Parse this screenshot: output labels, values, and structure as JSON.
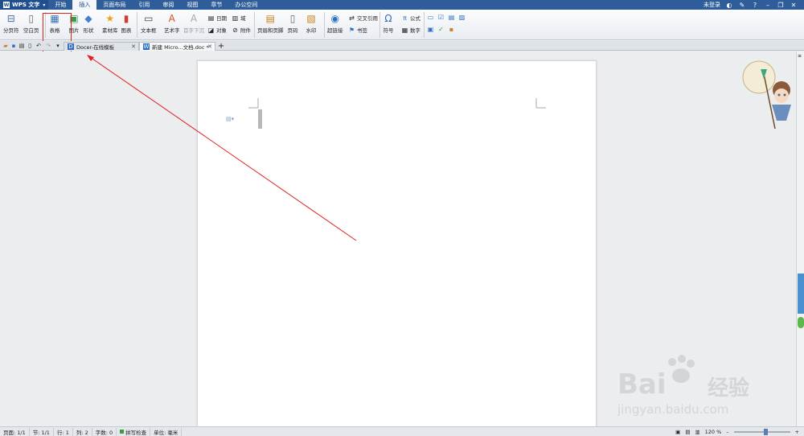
{
  "app": {
    "name": "WPS 文字",
    "login_status": "未登录"
  },
  "menu": {
    "tabs": [
      "开始",
      "插入",
      "页面布局",
      "引用",
      "审阅",
      "视图",
      "章节",
      "办公空间"
    ],
    "active_tab": "插入"
  },
  "ribbon": {
    "page_break": "分页符",
    "blank_page": "空白页",
    "table": "表格",
    "picture": "图片",
    "shape": "形状",
    "material": "素材库",
    "chart": "图表",
    "textbox": "文本框",
    "wordart": "艺术字",
    "drop_cap": "首字下沉",
    "date": "日期",
    "field": "域",
    "object": "对象",
    "attachment": "附件",
    "header_footer": "页眉和页脚",
    "page_number": "页码",
    "watermark": "水印",
    "hyperlink": "超链接",
    "cross_reference": "交叉引用",
    "bookmark": "书签",
    "symbol": "符号",
    "formula": "公式",
    "number": "数字"
  },
  "tabs": {
    "docer": "Docer-在线模板",
    "document": "新建 Micro...文档.doc *",
    "new_tab": "+"
  },
  "status": {
    "page": "页面: 1/1",
    "section": "节: 1/1",
    "row": "行: 1",
    "column": "列: 2",
    "word_count": "字数: 0",
    "spell_check": "拼写检查",
    "unit": "单位: 毫米",
    "zoom": "120 %",
    "zoom_level": 0.54
  },
  "watermark": {
    "brand": "Bai",
    "brand_cn": "经验",
    "url": "jingyan.baidu.com"
  },
  "colors": {
    "menubar": "#2f5d9a",
    "annotation": "#e02020",
    "accent": "#5a7fb5"
  }
}
